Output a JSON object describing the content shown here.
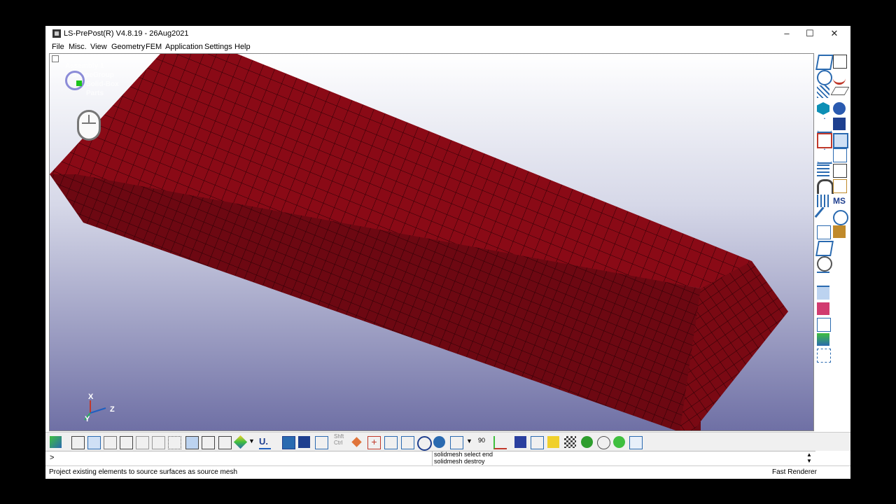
{
  "window": {
    "title": "LS-PrePost(R) V4.8.19 - 26Aug2021",
    "controls": {
      "minimize": "–",
      "maximize": "☐",
      "close": "✕"
    }
  },
  "menu": [
    "File",
    "Misc.",
    "View",
    "Geometry",
    "FEM",
    "Application",
    "Settings",
    "Help"
  ],
  "tree": {
    "assembly": "Assembly 1",
    "group": "ShapeGroup",
    "part": "Solid-Box",
    "parts": "Parts"
  },
  "axes": {
    "x": "X",
    "y": "Y",
    "z": "Z"
  },
  "toolbar": {
    "shift_ctrl": "Shft\nCtrl",
    "angle": "90",
    "mode_label": "U."
  },
  "command": {
    "prompt": ">",
    "history": [
      "solidmesh select end",
      "solidmesh destroy"
    ]
  },
  "status": {
    "message": "Project existing elements to source surfaces as source mesh",
    "renderer": "Fast Renderer"
  },
  "colors": {
    "mesh": "#8a0a16",
    "mesh_side": "#6d0812",
    "mesh_line": "#2a0005",
    "accent": "#1f5fbf"
  }
}
